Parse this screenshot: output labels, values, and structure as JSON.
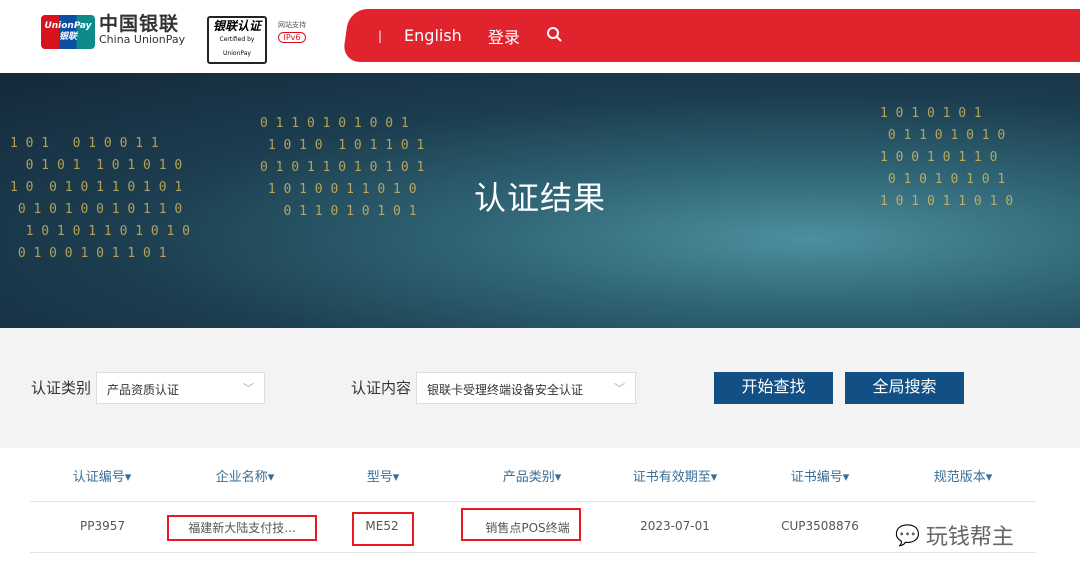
{
  "header": {
    "logo_card": "UnionPay 银联",
    "logo_cn": "中国银联",
    "logo_en": "China UnionPay",
    "cert_cn": "银联认证",
    "cert_en": "Certified by UnionPay",
    "ipv6_label": "网站支持",
    "ipv6_badge": "IPv6",
    "nav": {
      "separator": "|",
      "english": "English",
      "login": "登录",
      "search_icon": "search-icon"
    }
  },
  "banner": {
    "title": "认证结果"
  },
  "search": {
    "category_label": "认证类别",
    "category_value": "产品资质认证",
    "content_label": "认证内容",
    "content_value": "银联卡受理终端设备安全认证",
    "start_button": "开始查找",
    "global_button": "全局搜索"
  },
  "table": {
    "columns": [
      "认证编号▾",
      "企业名称▾",
      "型号▾",
      "产品类别▾",
      "证书有效期至▾",
      "证书编号▾",
      "规范版本▾"
    ],
    "rows": [
      {
        "cert_no": "PP3957",
        "company": "福建新大陆支付技...",
        "model": "ME52",
        "category": "销售点POS终端",
        "valid_until": "2023-07-01",
        "cert_number": "CUP3508876"
      }
    ]
  },
  "watermark": "玩钱帮主",
  "colors": {
    "brand_red": "#e1232e",
    "button_blue": "#114f84",
    "highlight_red": "#e8191e"
  }
}
